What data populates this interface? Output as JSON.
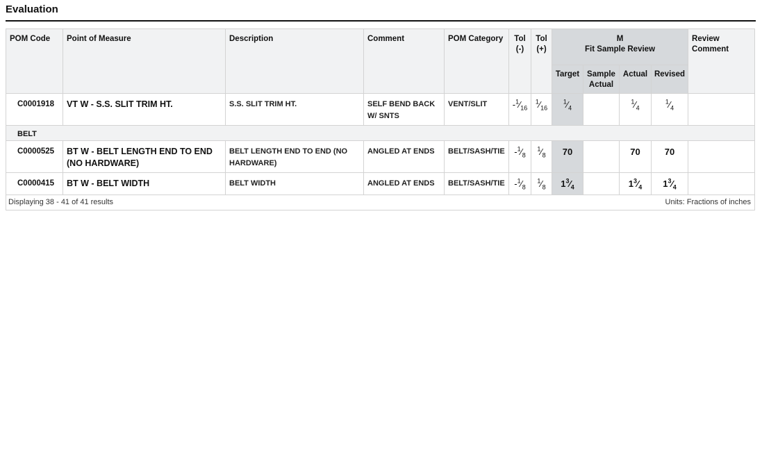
{
  "section": {
    "title": "Evaluation"
  },
  "table": {
    "headers": {
      "pom_code": "POM Code",
      "point_of_measure": "Point of Measure",
      "description": "Description",
      "comment": "Comment",
      "pom_category": "POM Category",
      "tol_minus_a": "Tol",
      "tol_minus_b": "(-)",
      "tol_plus_a": "Tol",
      "tol_plus_b": "(+)",
      "size_label": "M",
      "fit_review": "Fit Sample Review",
      "target": "Target",
      "sample_actual_a": "Sample",
      "sample_actual_b": "Actual",
      "actual": "Actual",
      "revised": "Revised",
      "review_comment_a": "Review",
      "review_comment_b": "Comment"
    },
    "rows": [
      {
        "code": "C0001918",
        "pom": "VT W - S.S. SLIT TRIM HT.",
        "description": "S.S. SLIT TRIM HT.",
        "comment": "SELF BEND BACK W/ SNTS",
        "category": "VENT/SLIT",
        "tol_minus": {
          "sign": "-",
          "num": "1",
          "den": "16"
        },
        "tol_plus": {
          "num": "1",
          "den": "16"
        },
        "target": {
          "whole": "",
          "num": "1",
          "den": "4"
        },
        "sample_actual": "",
        "actual": {
          "whole": "",
          "num": "1",
          "den": "4"
        },
        "revised": {
          "whole": "",
          "num": "1",
          "den": "4"
        },
        "review_comment": ""
      },
      {
        "code": "C0000525",
        "pom": "BT W - BELT LENGTH END TO END (NO HARDWARE)",
        "description": "BELT LENGTH END TO END (NO HARDWARE)",
        "comment": "ANGLED AT ENDS",
        "category": "BELT/SASH/TIE",
        "tol_minus": {
          "sign": "-",
          "num": "1",
          "den": "8"
        },
        "tol_plus": {
          "num": "1",
          "den": "8"
        },
        "target": {
          "whole": "70",
          "num": "",
          "den": ""
        },
        "sample_actual": "",
        "actual": {
          "whole": "70",
          "num": "",
          "den": ""
        },
        "revised": {
          "whole": "70",
          "num": "",
          "den": ""
        },
        "review_comment": ""
      },
      {
        "code": "C0000415",
        "pom": "BT W - BELT WIDTH",
        "description": "BELT WIDTH",
        "comment": "ANGLED AT ENDS",
        "category": "BELT/SASH/TIE",
        "tol_minus": {
          "sign": "-",
          "num": "1",
          "den": "8"
        },
        "tol_plus": {
          "num": "1",
          "den": "8"
        },
        "target": {
          "whole": "1",
          "num": "3",
          "den": "4"
        },
        "sample_actual": "",
        "actual": {
          "whole": "1",
          "num": "3",
          "den": "4"
        },
        "revised": {
          "whole": "1",
          "num": "3",
          "den": "4"
        },
        "review_comment": ""
      }
    ],
    "group_label": "BELT"
  },
  "footer": {
    "results": "Displaying 38 - 41 of 41 results",
    "units": "Units: Fractions of inches"
  },
  "colors": {
    "header_bg": "#f1f2f3",
    "fit_review_bg": "#d6d9dc",
    "border": "#d3d3d3"
  }
}
